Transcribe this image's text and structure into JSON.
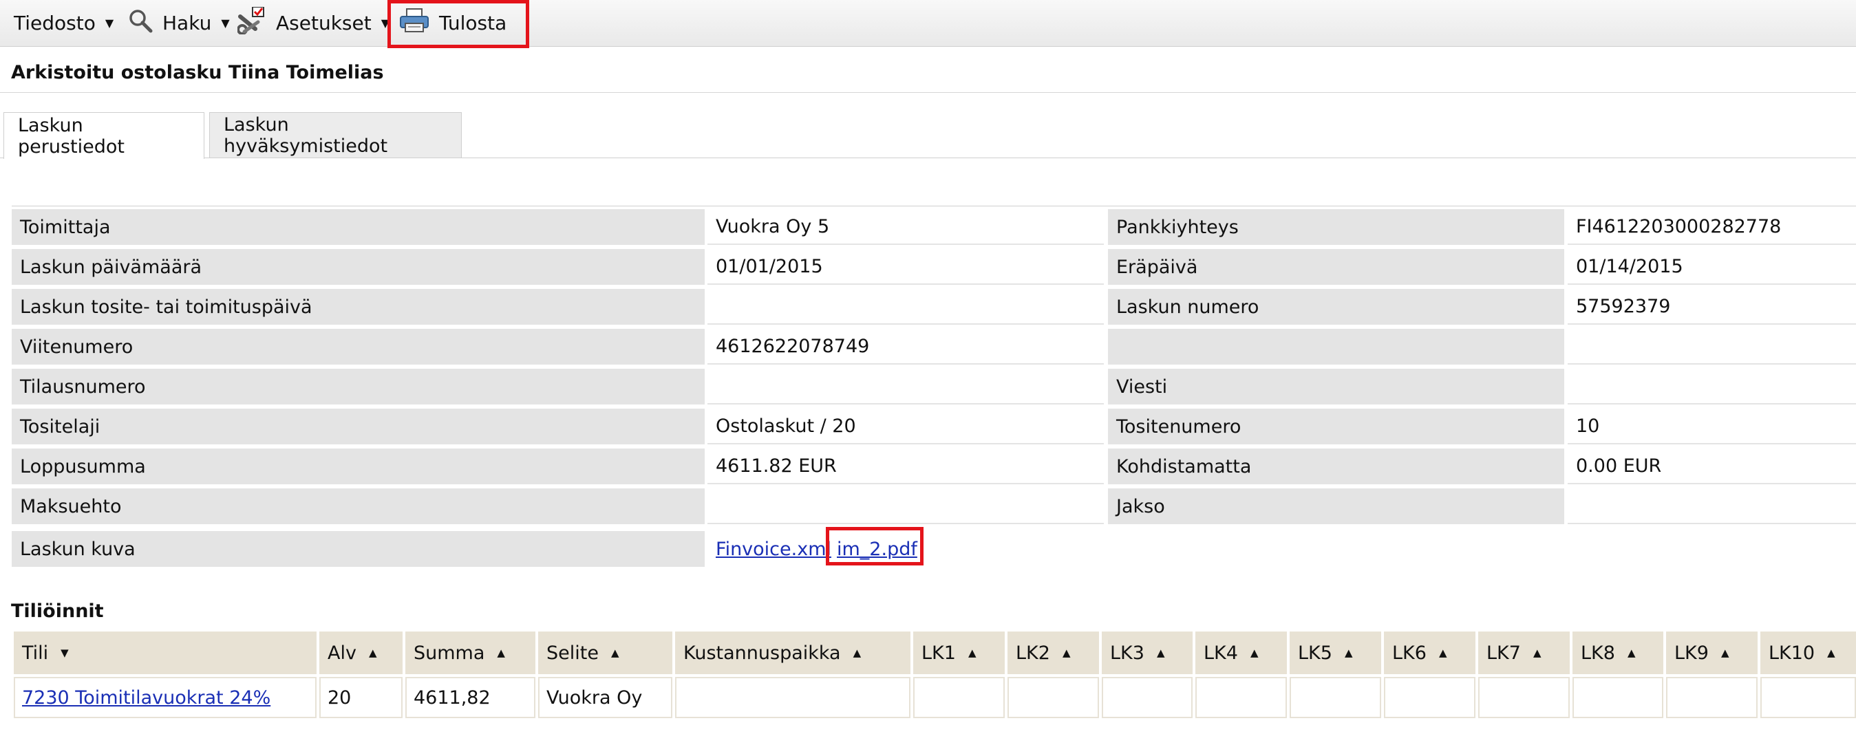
{
  "toolbar": {
    "file": "Tiedosto",
    "search": "Haku",
    "settings": "Asetukset",
    "print": "Tulosta"
  },
  "page_title": "Arkistoitu ostolasku Tiina Toimelias",
  "tabs": [
    "Laskun perustiedot",
    "Laskun hyväksymistiedot"
  ],
  "details": {
    "rows": [
      {
        "label1": "Toimittaja",
        "value1": "Vuokra Oy  5",
        "label2": "Pankkiyhteys",
        "value2": "FI4612203000282778"
      },
      {
        "label1": "Laskun päivämäärä",
        "value1": "01/01/2015",
        "label2": "Eräpäivä",
        "value2": "01/14/2015"
      },
      {
        "label1": "Laskun tosite- tai toimituspäivä",
        "value1": "",
        "label2": "Laskun numero",
        "value2": "57592379"
      },
      {
        "label1": "Viitenumero",
        "value1": "4612622078749",
        "label2": "",
        "value2": ""
      },
      {
        "label1": "Tilausnumero",
        "value1": "",
        "label2": "Viesti",
        "value2": ""
      },
      {
        "label1": "Tositelaji",
        "value1": "Ostolaskut / 20",
        "label2": "Tositenumero",
        "value2": "10"
      },
      {
        "label1": "Loppusumma",
        "value1": "4611.82 EUR",
        "label2": "Kohdistamatta",
        "value2": "0.00 EUR"
      },
      {
        "label1": "Maksuehto",
        "value1": "",
        "label2": "Jakso",
        "value2": ""
      }
    ],
    "image_label": "Laskun kuva",
    "image_link_1": "Finvoice.xml",
    "image_link_2": "im_2.pdf"
  },
  "accounting": {
    "title": "Tiliöinnit",
    "columns": [
      "Tili",
      "Alv",
      "Summa",
      "Selite",
      "Kustannuspaikka",
      "LK1",
      "LK2",
      "LK3",
      "LK4",
      "LK5",
      "LK6",
      "LK7",
      "LK8",
      "LK9",
      "LK10"
    ],
    "rows": [
      {
        "account": "7230 Toimitilavuokrat 24%",
        "vat": "20",
        "amount": "4611,82",
        "description": "Vuokra Oy",
        "cost_center": "",
        "lk": [
          "",
          "",
          "",
          "",
          "",
          "",
          "",
          "",
          "",
          ""
        ]
      }
    ]
  },
  "colors": {
    "highlight": "#e4141b",
    "link": "#1a2fb5",
    "label_bg": "#e4e4e4",
    "table_header_bg": "#e8e2d4"
  }
}
